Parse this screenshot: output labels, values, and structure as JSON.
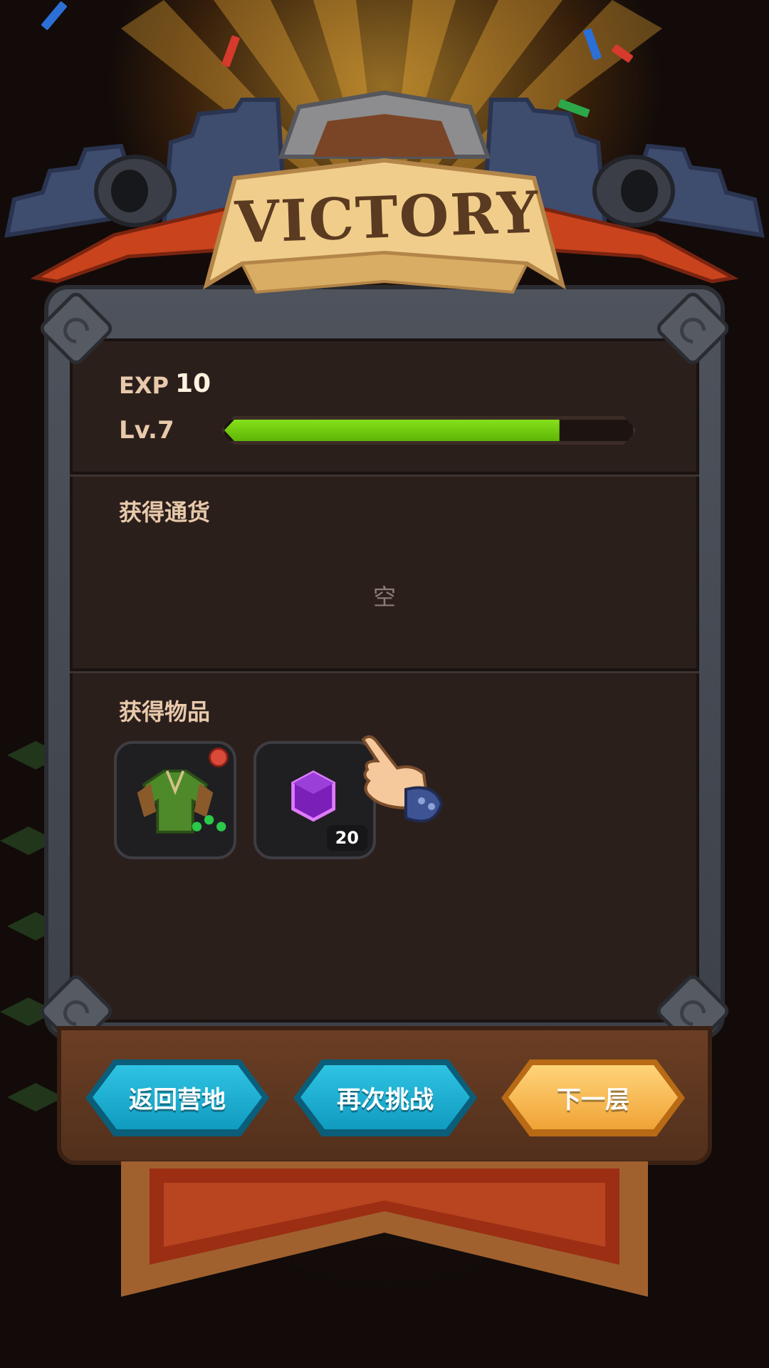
{
  "header": {
    "title": "VICTORY"
  },
  "progress": {
    "exp_label": "EXP",
    "exp_value": "10",
    "level_label": "Lv.7",
    "level_progress": 0.82
  },
  "currency_section": {
    "title": "获得通货",
    "empty_text": "空"
  },
  "items_section": {
    "title": "获得物品",
    "items": [
      {
        "name": "green-tunic-icon",
        "quantity": ""
      },
      {
        "name": "purple-cube-icon",
        "quantity": "20"
      }
    ]
  },
  "buttons": {
    "return_camp": "返回营地",
    "retry": "再次挑战",
    "next_floor": "下一层"
  },
  "colors": {
    "exp_bar": "#7ad412",
    "button_blue": "#1fb3d6",
    "button_orange": "#f5b64a",
    "panel": "#2b1f1c"
  }
}
